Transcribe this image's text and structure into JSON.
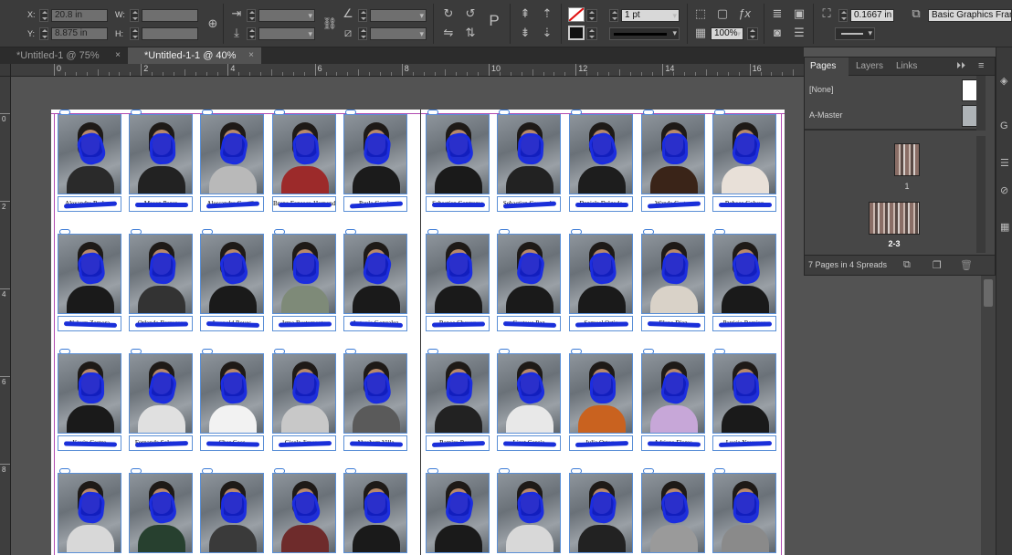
{
  "control_bar": {
    "x_label": "X:",
    "x_value": "20.8 in",
    "y_label": "Y:",
    "y_value": "8.875 in",
    "w_label": "W:",
    "h_label": "H:",
    "stroke_weight": "1 pt",
    "zoom": "100%",
    "offset_value": "0.1667 in",
    "object_style": "Basic Graphics Frame"
  },
  "tabs": [
    {
      "label": "*Untitled-1 @ 75%",
      "close": "×"
    },
    {
      "label": "*Untitled-1-1 @ 40%",
      "close": "×"
    }
  ],
  "ruler": {
    "top": [
      "0",
      "2",
      "4",
      "6",
      "8",
      "10",
      "12",
      "14",
      "16"
    ],
    "left": [
      "0",
      "2",
      "4",
      "6",
      "8"
    ]
  },
  "pages_panel": {
    "tabs": [
      "Pages",
      "Layers",
      "Links"
    ],
    "masters": [
      "[None]",
      "A-Master"
    ],
    "spreads": [
      "1",
      "2-3"
    ],
    "status": "7 Pages in 4 Spreads",
    "master_none_color": "#ffffff",
    "master_a_color": "#aeb3b7"
  },
  "spread": {
    "captions": [
      [
        "Alexandra Barbosa",
        "Mason Perez",
        "Alessandro Castillo",
        "Bruna Fonseca-Hernandez",
        "Paula Garcia",
        "Sebastian Contreras",
        "Sebastian Coronado",
        "Daniela Delgado",
        "Wanda Cortez",
        "Rebeca Galvez"
      ],
      [
        "Nahum Zamora",
        "Orlando Barragan",
        "Leopold Reyes",
        "Irma Bustamante",
        "Antonia Gonzalez",
        "Renee Chavez",
        "Gustavo Paz",
        "Samuel Ortiz",
        "Elena Diaz",
        "Patricia Ramirez"
      ],
      [
        "Kevin Castro",
        "Fernanda Solorzano",
        "Cher Coss",
        "Gisela Jimenez",
        "Abraham Villa",
        "Ramiro Reyes",
        "Lizet Garcia",
        "Julia Ortega",
        "Adriana Flores",
        "Lucia Navarro"
      ]
    ],
    "shirt_colors": [
      [
        "#2a2a2a",
        "#222",
        "#b9b9b9",
        "#9c2a2a",
        "#1b1b1b",
        "#1a1a1a",
        "#222",
        "#1d1d1d",
        "#3a2418",
        "#e8e0d8"
      ],
      [
        "#1a1a1a",
        "#333",
        "#1a1a1a",
        "#7e8a78",
        "#1a1a1a",
        "#1a1a1a",
        "#1a1a1a",
        "#1a1a1a",
        "#d9d2c8",
        "#1a1a1a"
      ],
      [
        "#1a1a1a",
        "#e0e0e0",
        "#f2f2f2",
        "#c8c8c8",
        "#5a5a5a",
        "#222",
        "#e8e8e8",
        "#c9621f",
        "#c7a7d8",
        "#1a1a1a"
      ],
      [
        "#d8d8d8",
        "#27402f",
        "#3a3a3a",
        "#6e2b2b",
        "#1a1a1a",
        "#1a1a1a",
        "#d8d8d8",
        "#222",
        "#9a9a9a",
        "#8a8a8a"
      ]
    ]
  }
}
